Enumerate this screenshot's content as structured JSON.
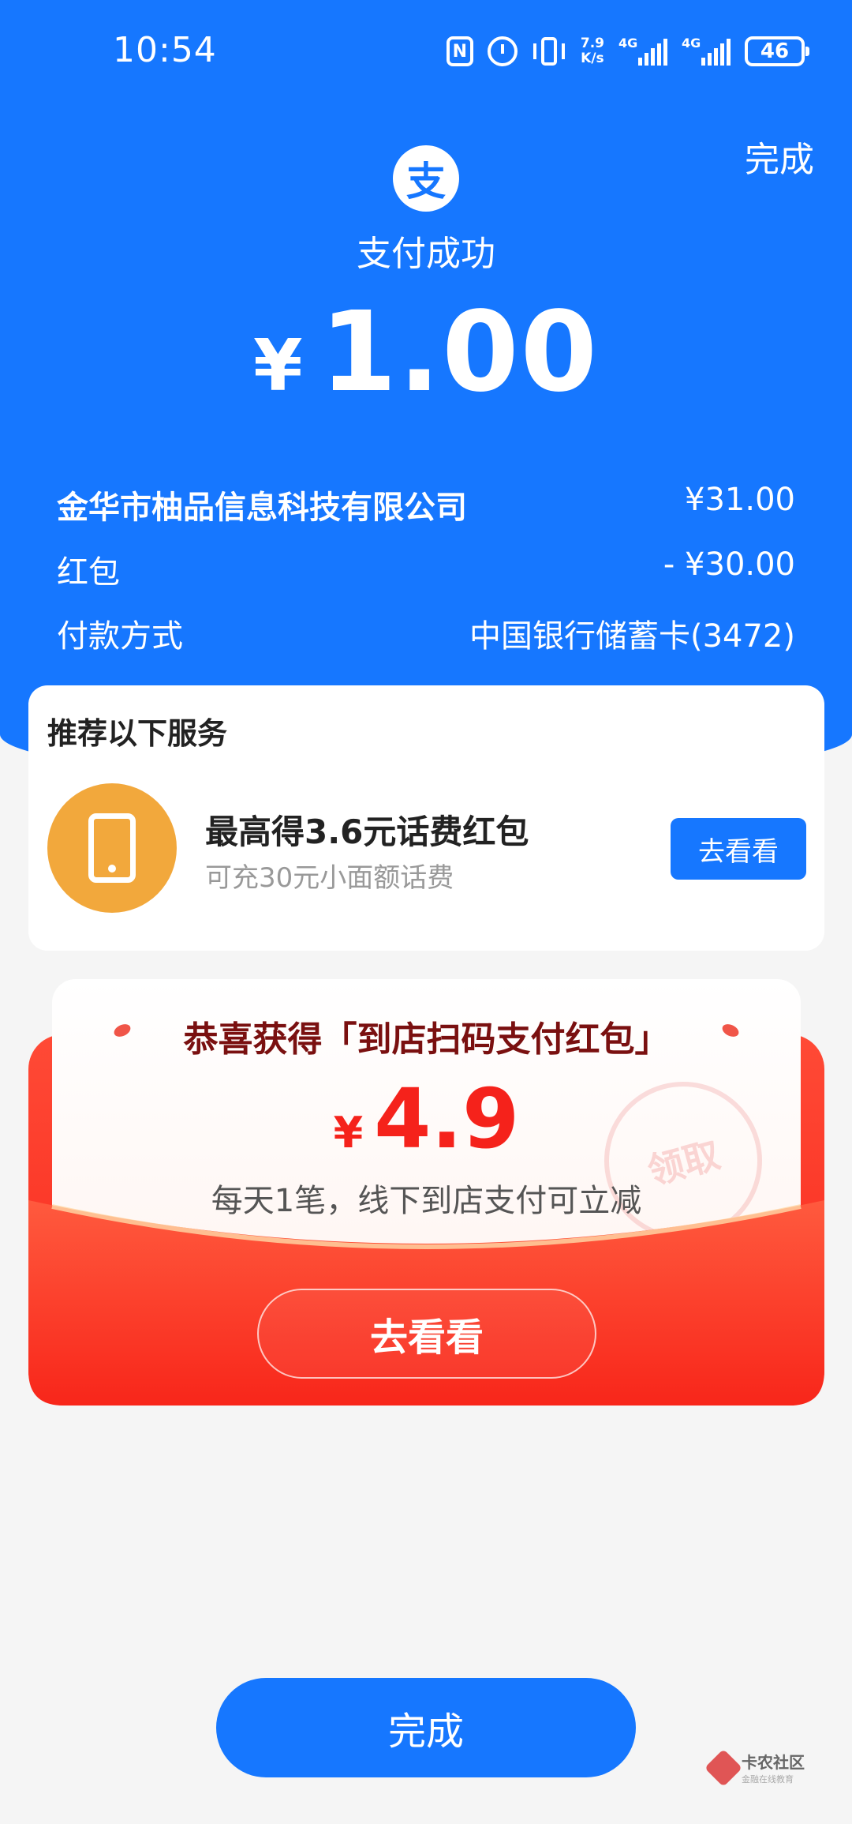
{
  "status_bar": {
    "time": "10:54",
    "nfc": "N",
    "speed_value": "7.9",
    "speed_unit": "K/s",
    "net1": "4G",
    "net2": "4G",
    "battery": "46"
  },
  "header": {
    "done_label": "完成",
    "logo_char": "支",
    "title": "支付成功",
    "currency": "¥",
    "amount": "1.00"
  },
  "details": [
    {
      "label": "金华市柚品信息科技有限公司",
      "value": "¥31.00"
    },
    {
      "label": "红包",
      "value": "- ¥30.00"
    },
    {
      "label": "付款方式",
      "value": "中国银行储蓄卡(3472)"
    }
  ],
  "recommend": {
    "title": "推荐以下服务",
    "icon": "phone-icon",
    "main_text": "最高得3.6元话费红包",
    "sub_text": "可充30元小面额话费",
    "button_label": "去看看"
  },
  "red_packet": {
    "title": "恭喜获得「到店扫码支付红包」",
    "currency": "¥",
    "amount": "4.9",
    "description": "每天1笔，线下到店支付可立减",
    "stamp_text": "领取",
    "button_label": "去看看"
  },
  "footer": {
    "done_label": "完成"
  },
  "watermark": {
    "main": "卡农社区",
    "sub": "金融在线教育"
  },
  "colors": {
    "primary_blue": "#1677ff",
    "red": "#f8261a",
    "orange_icon": "#f2a83c"
  }
}
